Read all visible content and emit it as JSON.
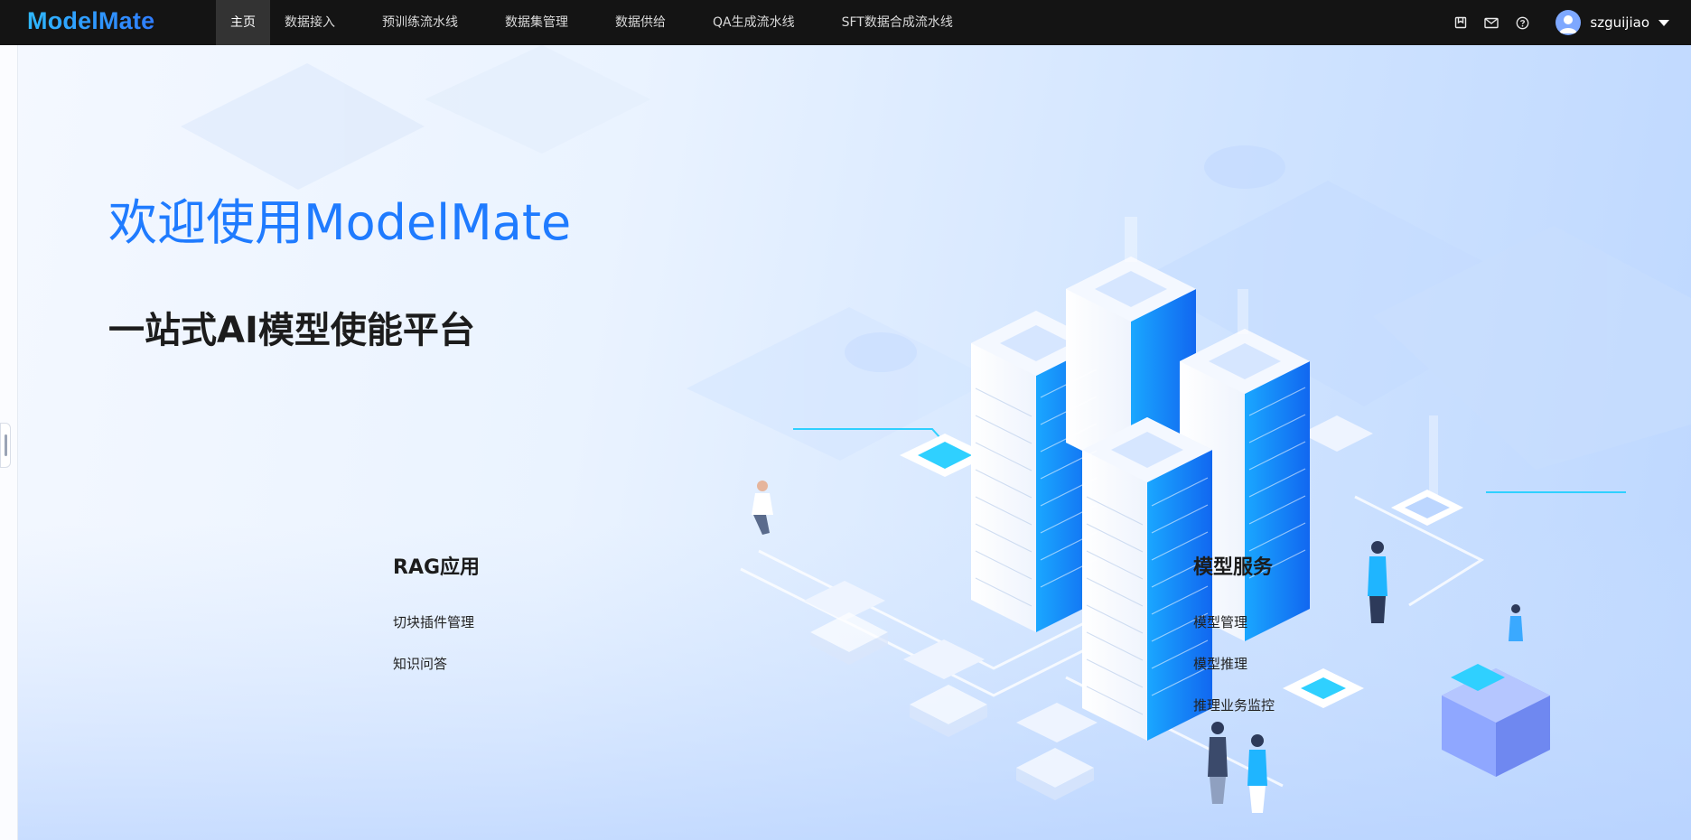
{
  "app": {
    "logo": "ModelMate"
  },
  "nav": {
    "items": [
      {
        "label": "主页",
        "active": true
      },
      {
        "label": "数据接入"
      },
      {
        "label": "预训练流水线"
      },
      {
        "label": "数据集管理"
      },
      {
        "label": "数据供给"
      },
      {
        "label": "QA生成流水线"
      },
      {
        "label": "SFT数据合成流水线"
      }
    ]
  },
  "header_icons": [
    "bookmark-icon",
    "mail-icon",
    "help-icon"
  ],
  "user": {
    "name": "szguijiao"
  },
  "hero": {
    "welcome": "欢迎使用ModelMate",
    "subtitle": "一站式AI模型使能平台"
  },
  "rag": {
    "title": "RAG应用",
    "links": [
      "切块插件管理",
      "知识问答"
    ]
  },
  "model_service": {
    "title": "模型服务",
    "links": [
      "模型管理",
      "模型推理",
      "推理业务监控"
    ]
  },
  "colors": {
    "accent": "#1f7bff",
    "topbar": "#141414",
    "server_blue": "#1a8cff"
  }
}
